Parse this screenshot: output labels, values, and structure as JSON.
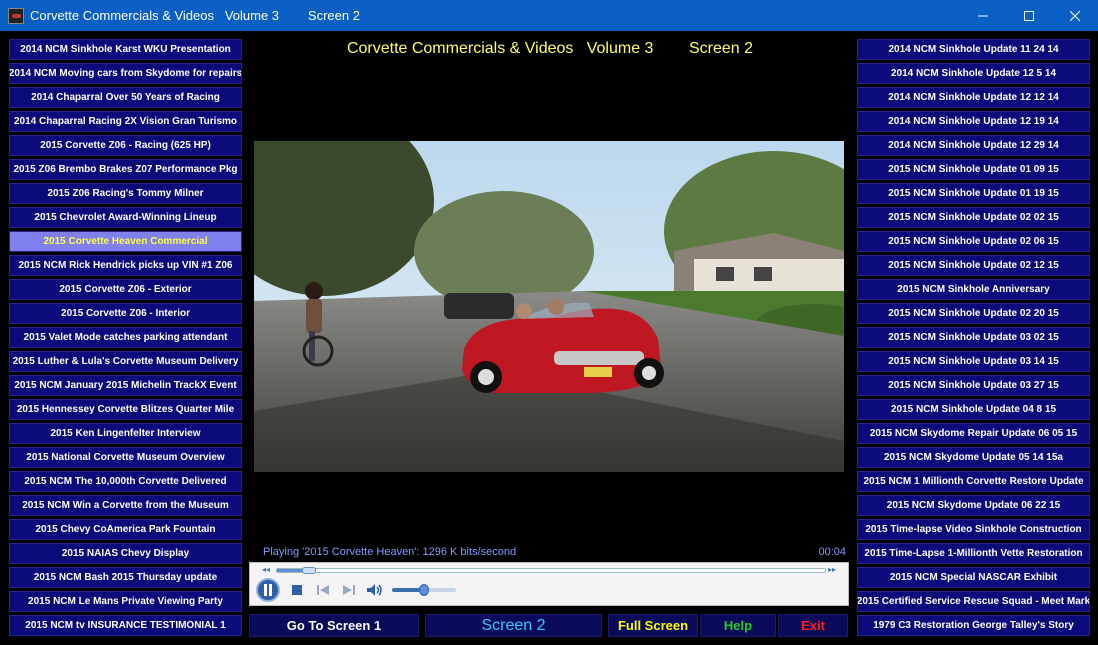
{
  "window": {
    "title": "Corvette Commercials & Videos   Volume 3        Screen 2",
    "minimize_icon": "minimize-icon",
    "maximize_icon": "maximize-icon",
    "close_icon": "close-icon"
  },
  "heading": "Corvette Commercials & Videos   Volume 3        Screen 2",
  "left_list": [
    "2014 NCM Sinkhole Karst WKU Presentation",
    "2014 NCM Moving cars from Skydome for repairs",
    "2014 Chaparral  Over 50 Years of Racing",
    "2014 Chaparral Racing 2X Vision Gran Turismo",
    "2015 Corvette Z06 - Racing (625 HP)",
    "2015 Z06 Brembo Brakes Z07 Performance Pkg",
    "2015 Z06 Racing's Tommy Milner",
    "2015 Chevrolet Award-Winning Lineup",
    "2015 Corvette Heaven Commercial",
    "2015 NCM Rick Hendrick picks up VIN #1 Z06",
    "2015 Corvette Z06 - Exterior",
    "2015 Corvette Z06 - Interior",
    "2015 Valet Mode catches parking attendant",
    "2015 Luther & Lula's Corvette Museum Delivery",
    "2015 NCM January 2015 Michelin TrackX Event",
    "2015 Hennessey Corvette Blitzes Quarter Mile",
    "2015 Ken Lingenfelter Interview",
    "2015 National Corvette Museum Overview",
    "2015 NCM The 10,000th Corvette Delivered",
    "2015 NCM Win a Corvette from the Museum",
    "2015 Chevy CoAmerica Park Fountain",
    "2015 NAIAS Chevy Display",
    "2015 NCM Bash 2015 Thursday update",
    "2015 NCM Le Mans Private Viewing Party",
    "2015 NCM tv INSURANCE TESTIMONIAL 1"
  ],
  "left_active_index": 8,
  "right_list": [
    "2014 NCM Sinkhole Update 11 24 14",
    "2014 NCM Sinkhole Update 12 5 14",
    "2014 NCM Sinkhole Update 12 12 14",
    "2014 NCM Sinkhole Update 12 19 14",
    "2014 NCM Sinkhole Update 12 29 14",
    "2015 NCM Sinkhole Update 01 09 15",
    "2015 NCM Sinkhole Update 01 19 15",
    "2015 NCM Sinkhole Update 02 02 15",
    "2015 NCM Sinkhole Update 02 06 15",
    "2015 NCM Sinkhole Update 02 12 15",
    "2015 NCM Sinkhole Anniversary",
    "2015 NCM Sinkhole Update 02 20 15",
    "2015 NCM Sinkhole Update 03 02 15",
    "2015 NCM Sinkhole Update 03 14 15",
    "2015 NCM Sinkhole Update 03 27 15",
    "2015 NCM Sinkhole Update  04 8 15",
    "2015 NCM Skydome Repair Update 06 05 15",
    "2015 NCM Skydome Update 05 14 15a",
    "2015 NCM 1 Millionth Corvette Restore Update",
    "2015 NCM Skydome Update 06 22 15",
    "2015 Time-lapse Video Sinkhole Construction",
    "2015 Time-Lapse 1-Millionth Vette Restoration",
    "2015 NCM Special NASCAR Exhibit",
    "2015 Certified Service Rescue Squad - Meet Mark",
    "1979 C3 Restoration  George Talley's Story"
  ],
  "player": {
    "status_text": "Playing '2015 Corvette Heaven': 1296 K bits/second",
    "time": "00:04",
    "seek_progress": 0.05,
    "volume_level": 0.5,
    "icons": [
      "rewind-icon",
      "fast-forward-icon",
      "pause-icon",
      "stop-icon",
      "previous-icon",
      "next-icon",
      "volume-icon"
    ]
  },
  "bottom_nav": {
    "goto_label": "Go To Screen 1",
    "screen_label": "Screen 2",
    "fullscreen_label": "Full Screen",
    "help_label": "Help",
    "exit_label": "Exit"
  },
  "colors": {
    "titlebar": "#0a5fc4",
    "list_button": "#0a0a7a",
    "list_active": "#8080ee",
    "active_text": "#ffff40",
    "heading": "#ffff66",
    "status": "#8899ff",
    "screen_label": "#33ccff",
    "fullscreen": "#ffff00",
    "help": "#22cc22",
    "exit": "#ff2020"
  }
}
